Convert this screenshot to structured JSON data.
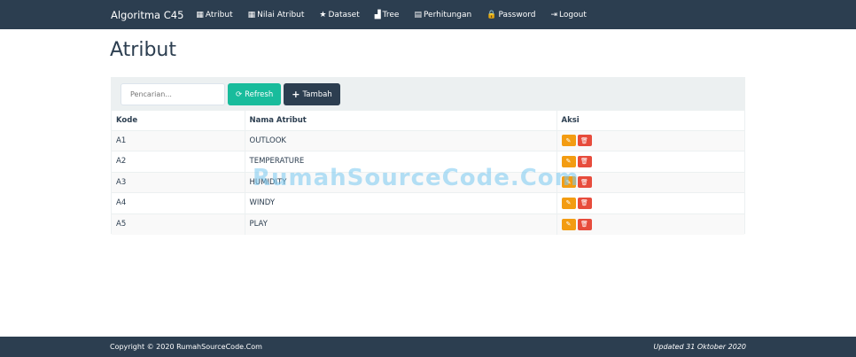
{
  "nav": {
    "brand": "Algoritma C45",
    "items": [
      {
        "label": "Atribut",
        "icon": "th-large-icon",
        "glyph": "▦"
      },
      {
        "label": "Nilai Atribut",
        "icon": "th-icon",
        "glyph": "▦"
      },
      {
        "label": "Dataset",
        "icon": "star-icon",
        "glyph": "★"
      },
      {
        "label": "Tree",
        "icon": "signal-icon",
        "glyph": "▟"
      },
      {
        "label": "Perhitungan",
        "icon": "calendar-icon",
        "glyph": "▤"
      },
      {
        "label": "Password",
        "icon": "lock-icon",
        "glyph": "🔒"
      },
      {
        "label": "Logout",
        "icon": "log-out-icon",
        "glyph": "⇥"
      }
    ]
  },
  "page": {
    "title": "Atribut"
  },
  "toolbar": {
    "search_placeholder": "Pencarian...",
    "refresh_label": "Refresh",
    "tambah_label": "Tambah"
  },
  "table": {
    "headers": [
      "Kode",
      "Nama Atribut",
      "Aksi"
    ],
    "rows": [
      {
        "kode": "A1",
        "nama": "OUTLOOK"
      },
      {
        "kode": "A2",
        "nama": "TEMPERATURE"
      },
      {
        "kode": "A3",
        "nama": "HUMIDITY"
      },
      {
        "kode": "A4",
        "nama": "WINDY"
      },
      {
        "kode": "A5",
        "nama": "PLAY"
      }
    ]
  },
  "watermark": "RumahSourceCode.Com",
  "footer": {
    "copyright": "Copyright © 2020 RumahSourceCode.Com",
    "updated": "Updated 31 Oktober 2020"
  },
  "colors": {
    "primary": "#2c3e50",
    "success": "#18bc9c",
    "warning": "#f39c12",
    "danger": "#e74c3c"
  }
}
